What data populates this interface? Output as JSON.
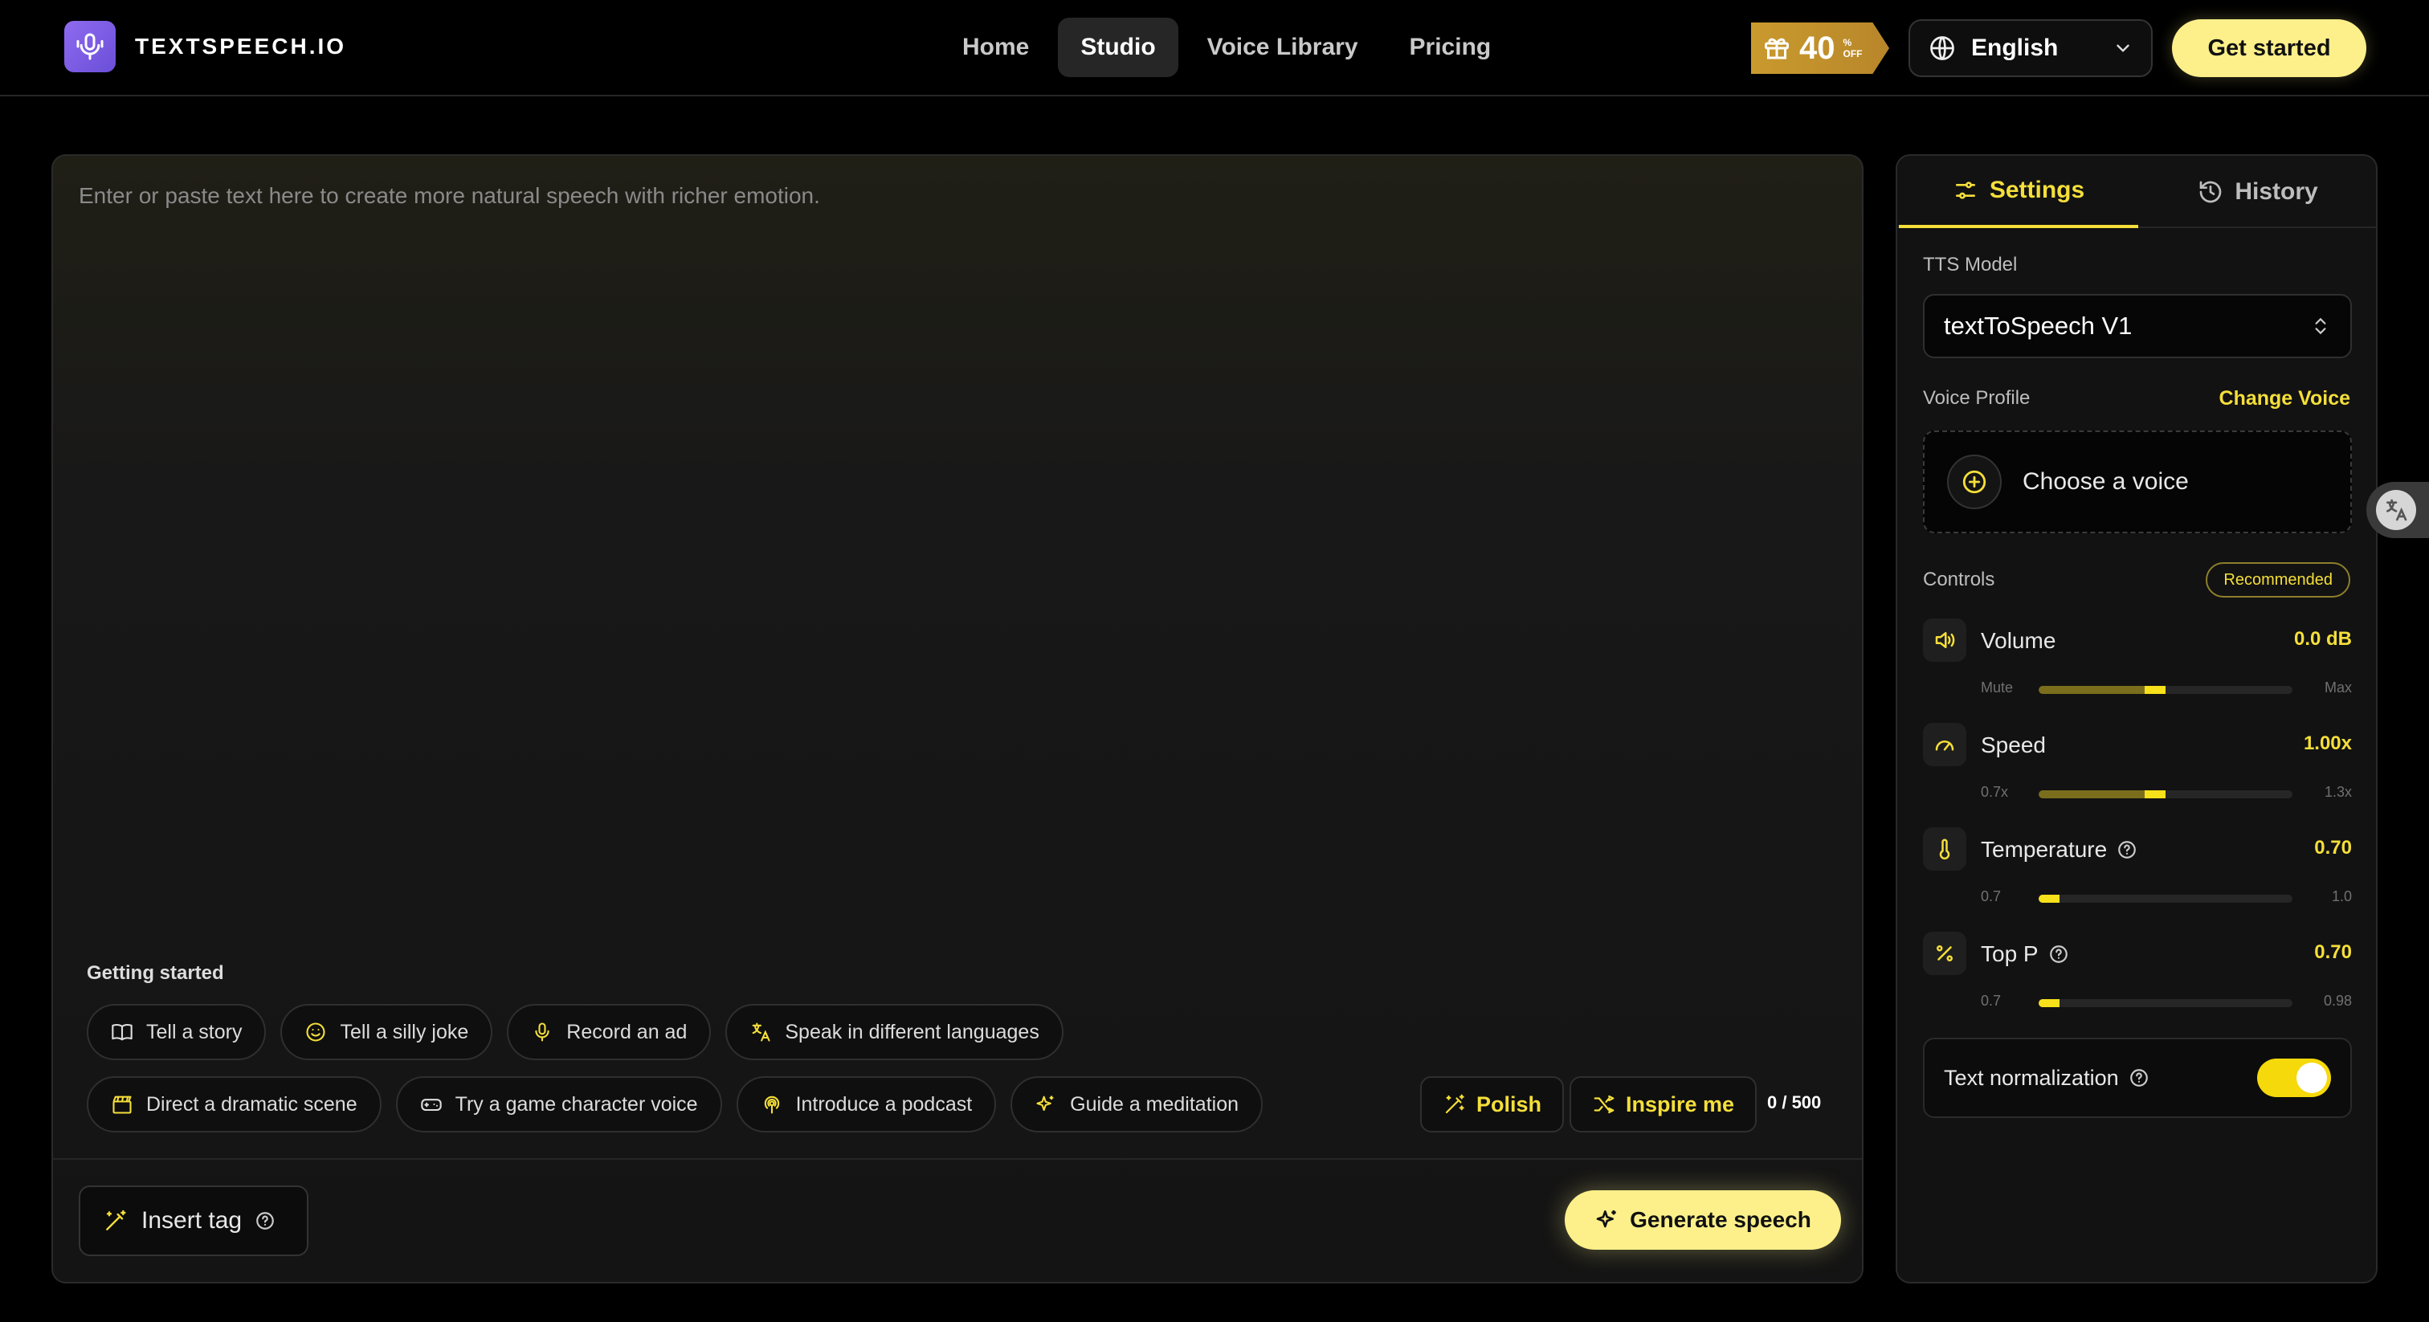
{
  "header": {
    "logo_text": "TEXTSPEECH.IO",
    "nav": [
      {
        "label": "Home",
        "active": false
      },
      {
        "label": "Studio",
        "active": true
      },
      {
        "label": "Voice Library",
        "active": false
      },
      {
        "label": "Pricing",
        "active": false
      }
    ],
    "promo": {
      "number": "40",
      "sup_top": "%",
      "sup_bottom": "OFF",
      "icon": "gift-icon"
    },
    "language": "English",
    "cta": "Get started"
  },
  "editor": {
    "placeholder": "Enter or paste text here to create more natural speech with richer emotion.",
    "getting_started_title": "Getting started",
    "chips_row1": [
      {
        "label": "Tell a story",
        "icon": "book-icon"
      },
      {
        "label": "Tell a silly joke",
        "icon": "smile-icon"
      },
      {
        "label": "Record an ad",
        "icon": "mic-icon"
      },
      {
        "label": "Speak in different languages",
        "icon": "translate-icon"
      }
    ],
    "chips_row2": [
      {
        "label": "Direct a dramatic scene",
        "icon": "clapperboard-icon"
      },
      {
        "label": "Try a game character voice",
        "icon": "gamepad-icon"
      },
      {
        "label": "Introduce a podcast",
        "icon": "podcast-icon"
      },
      {
        "label": "Guide a meditation",
        "icon": "sparkles-icon"
      }
    ],
    "polish_label": "Polish",
    "inspire_label": "Inspire me",
    "counter": "0 / 500",
    "insert_tag_label": "Insert tag",
    "generate_label": "Generate speech"
  },
  "settings": {
    "tabs": [
      {
        "label": "Settings",
        "active": true
      },
      {
        "label": "History",
        "active": false
      }
    ],
    "tts_model_label": "TTS Model",
    "tts_model_value": "textToSpeech V1",
    "voice_profile_label": "Voice Profile",
    "change_voice": "Change Voice",
    "choose_voice": "Choose a voice",
    "controls_label": "Controls",
    "recommended": "Recommended",
    "controls": [
      {
        "name": "Volume",
        "value": "0.0 dB",
        "min": "Mute",
        "max": "Max",
        "level": 0.5,
        "icon": "volume-icon"
      },
      {
        "name": "Speed",
        "value": "1.00x",
        "min": "0.7x",
        "max": "1.3x",
        "level": 0.5,
        "icon": "gauge-icon"
      },
      {
        "name": "Temperature",
        "value": "0.70",
        "min": "0.7",
        "max": "1.0",
        "level": 0.0,
        "icon": "thermometer-icon"
      },
      {
        "name": "Top P",
        "value": "0.70",
        "min": "0.7",
        "max": "0.98",
        "level": 0.0,
        "icon": "percent-icon"
      }
    ],
    "text_normalization": "Text normalization",
    "text_normalization_on": true
  },
  "colors": {
    "accent": "#f5df3a",
    "cta": "#fdf08a",
    "logo": "#8e6bf0"
  }
}
